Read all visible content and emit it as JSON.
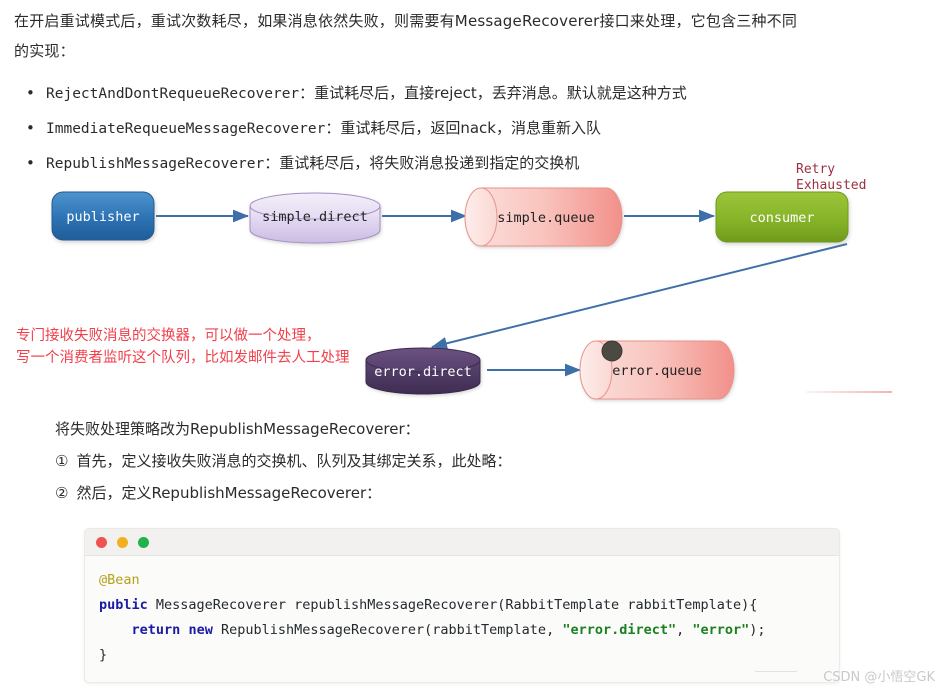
{
  "article": {
    "intro_line1": "在开启重试模式后，重试次数耗尽，如果消息依然失败，则需要有MessageRecoverer接口来处理，它包含三种不同",
    "intro_line2": "的实现：",
    "bullets": [
      {
        "name": "RejectAndDontRequeueRecoverer",
        "desc": "：重试耗尽后，直接reject，丢弃消息。默认就是这种方式"
      },
      {
        "name": "ImmediateRequeueMessageRecoverer",
        "desc": "：重试耗尽后，返回nack，消息重新入队"
      },
      {
        "name": "RepublishMessageRecoverer",
        "desc": "：重试耗尽后，将失败消息投递到指定的交换机"
      }
    ],
    "lower_heading": "将失败处理策略改为RepublishMessageRecoverer：",
    "steps": [
      {
        "mark": "①",
        "text": "首先，定义接收失败消息的交换机、队列及其绑定关系，此处略："
      },
      {
        "mark": "②",
        "text": "然后，定义RepublishMessageRecoverer："
      }
    ]
  },
  "diagram": {
    "nodes": {
      "publisher": "publisher",
      "simple_direct": "simple.direct",
      "simple_queue": "simple.queue",
      "consumer": "consumer",
      "error_direct": "error.direct",
      "error_queue": "error.queue"
    },
    "retry_label_line1": "Retry",
    "retry_label_line2": "Exhausted",
    "annotation_line1": "专门接收失败消息的交换器，可以做一个处理，",
    "annotation_line2": "写一个消费者监听这个队列，比如发邮件去人工处理",
    "colors": {
      "publisher": "#2b6cab",
      "exchange_purple": "#d9cdea",
      "queue_pink": "#f6a6a0",
      "consumer_green": "#86b327",
      "error_direct_purple": "#4e3a63",
      "arrow_blue": "#3f6fa8",
      "annotation_red": "#f1404b",
      "retry_text": "#9c3040",
      "message_dot": "#4a4a42"
    }
  },
  "code_card": {
    "traffic_lights": [
      "red",
      "yellow",
      "green"
    ],
    "lines": [
      [
        {
          "t": "@Bean",
          "k": "anno"
        }
      ],
      [
        {
          "t": "public",
          "k": "kw"
        },
        {
          "t": " MessageRecoverer republishMessageRecoverer(RabbitTemplate rabbitTemplate){",
          "k": "plain"
        }
      ],
      [
        {
          "t": "    ",
          "k": "plain"
        },
        {
          "t": "return",
          "k": "kw"
        },
        {
          "t": " ",
          "k": "plain"
        },
        {
          "t": "new",
          "k": "kw"
        },
        {
          "t": " RepublishMessageRecoverer(rabbitTemplate, ",
          "k": "plain"
        },
        {
          "t": "\"error.direct\"",
          "k": "str"
        },
        {
          "t": ", ",
          "k": "plain"
        },
        {
          "t": "\"error\"",
          "k": "str"
        },
        {
          "t": ");",
          "k": "plain"
        }
      ],
      [
        {
          "t": "}",
          "k": "plain"
        }
      ]
    ]
  },
  "watermark": {
    "text": "CSDN @小悟空GK"
  }
}
